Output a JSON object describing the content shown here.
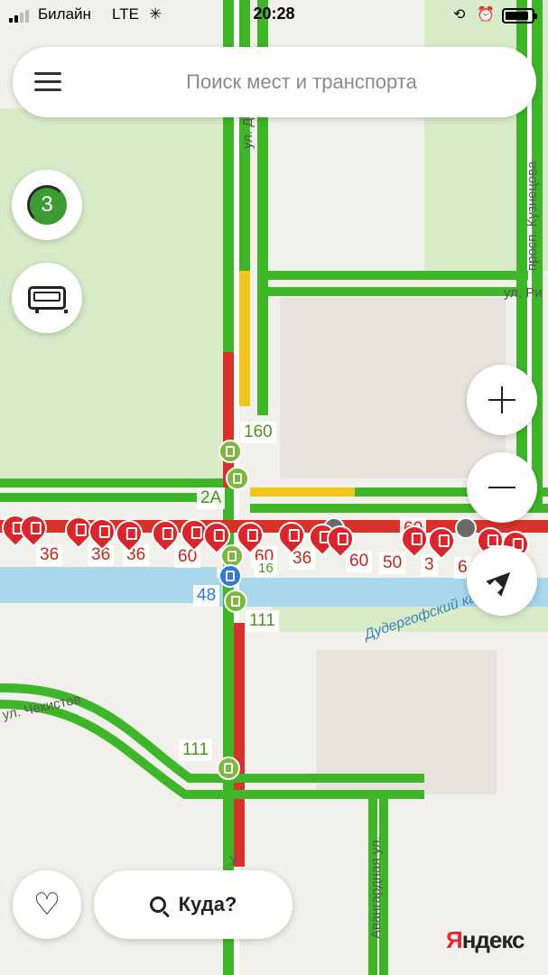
{
  "status_bar": {
    "carrier": "Билайн",
    "network": "LTE",
    "time": "20:28",
    "battery_level": 0.88
  },
  "search": {
    "placeholder": "Поиск мест и транспорта"
  },
  "controls": {
    "traffic_score": "3",
    "route_button_label": "Куда?"
  },
  "map": {
    "streets": [
      "ул. Добле",
      "ул. Ри",
      "просп. Кузнецова",
      "ул. Чекистов",
      "Авангардная ул.",
      "У"
    ],
    "canal": "Дудергофский канал",
    "routes": {
      "r160": "160",
      "r2a": "2А",
      "r48": "48",
      "r111_a": "111",
      "r111_b": "111",
      "r36_a": "36",
      "r36_b": "36",
      "r36_c": "36",
      "r36_d": "36",
      "r60_a": "60",
      "r60_b": "60",
      "r60_c": "60",
      "r60_d": "60",
      "r60_e": "60",
      "r3": "3",
      "r6": "6",
      "r50": "50",
      "r16": "16"
    }
  },
  "logo": "Яндекс",
  "colors": {
    "traffic_green": "#3fb52a",
    "traffic_yellow": "#f0c51e",
    "traffic_red": "#d8312a",
    "transit_red": "#d9262c",
    "stop_green": "#7db83e",
    "stop_blue": "#2f7bd6"
  },
  "icons": {
    "menu": "menu-icon",
    "traffic": "traffic-icon",
    "transport": "bus-icon",
    "zoom_in": "plus-icon",
    "zoom_out": "minus-icon",
    "locate": "location-arrow-icon",
    "favorites": "heart-icon",
    "search": "search-icon"
  }
}
